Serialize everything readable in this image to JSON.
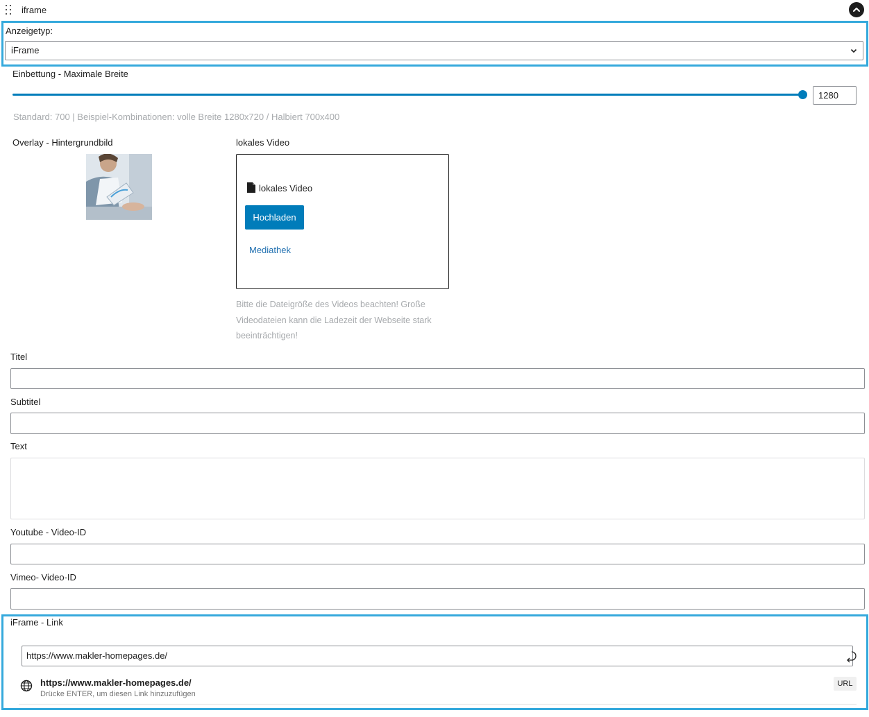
{
  "block": {
    "title": "iframe",
    "drag_icon": "drag-handle-icon",
    "collapse_icon": "chevron-up-icon"
  },
  "display_type": {
    "label": "Anzeigetyp:",
    "value": "iFrame"
  },
  "embed_width": {
    "label": "Einbettung - Maximale Breite",
    "value": "1280",
    "slider_fraction": 0.99,
    "help": "Standard: 700 | Beispiel-Kombinationen: volle Breite 1280x720 / Halbiert 700x400"
  },
  "overlay": {
    "label": "Overlay - Hintergrundbild"
  },
  "local_video": {
    "label": "lokales Video",
    "placeholder_title": "lokales Video",
    "upload_button": "Hochladen",
    "media_link": "Mediathek",
    "note": "Bitte die Dateigröße des Videos beachten! Große Videodateien kann die Ladezeit der Webseite stark beeinträchtigen!"
  },
  "fields": {
    "title_label": "Titel",
    "subtitle_label": "Subtitel",
    "text_label": "Text",
    "youtube_label": "Youtube - Video-ID",
    "vimeo_label": "Vimeo- Video-ID"
  },
  "iframe_link": {
    "label": "iFrame - Link",
    "value": "https://www.makler-homepages.de/",
    "suggestion_title": "https://www.makler-homepages.de/",
    "suggestion_hint": "Drücke ENTER, um diesen Link hinzuzufügen",
    "badge": "URL"
  },
  "colors": {
    "accent": "#007cba",
    "highlight": "#35a9dc",
    "link": "#2271b1"
  }
}
